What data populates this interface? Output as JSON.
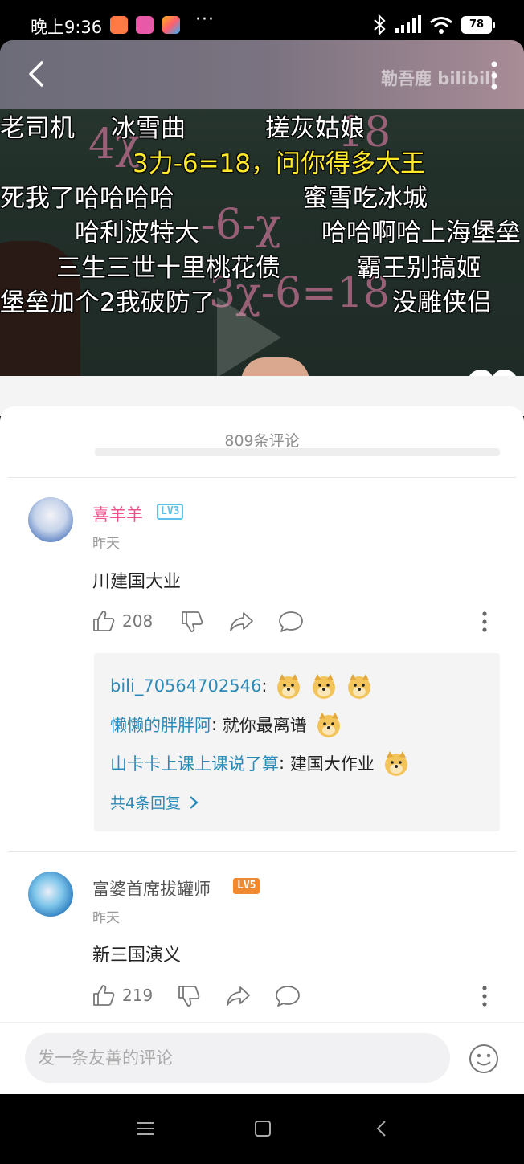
{
  "status_bar": {
    "time": "晚上9:36",
    "dots": "···",
    "battery": "78",
    "app_icon_colors": [
      "#ff7a45",
      "#e85aa8",
      "#ffb21a"
    ]
  },
  "video": {
    "watermark": "勒吾鹿 bilibili",
    "icons": {
      "back": "chevron-left-icon",
      "menu": "more-vertical-icon",
      "heart": "heart-icon"
    },
    "danmaku": [
      {
        "text": "老司机",
        "color": "white"
      },
      {
        "text": "冰雪曲",
        "color": "white"
      },
      {
        "text": "搓灰姑娘",
        "color": "white"
      },
      {
        "text": "3力-6=18，问你得多大王",
        "color": "yellow"
      },
      {
        "text": "死我了哈哈哈哈",
        "color": "white"
      },
      {
        "text": "蜜雪吃冰城",
        "color": "white"
      },
      {
        "text": "哈利波特大",
        "color": "white"
      },
      {
        "text": "哈哈啊哈上海堡垒",
        "color": "white"
      },
      {
        "text": "三生三世十里桃花债",
        "color": "white"
      },
      {
        "text": "霸王别搞姬",
        "color": "white"
      },
      {
        "text": "堡垒加个2我破防了",
        "color": "white"
      },
      {
        "text": "没雕侠侣",
        "color": "white"
      }
    ]
  },
  "comments_header": {
    "count_label": "809条评论"
  },
  "comments": [
    {
      "user": "喜羊羊",
      "level": "LV3",
      "level_color": "#5cc2e6",
      "name_color": "#f0508c",
      "time": "昨天",
      "text": "川建国大业",
      "likes": "208",
      "replies": [
        {
          "name": "bili_70564702546",
          "text": ""
        },
        {
          "name": "懒懒的胖胖阿",
          "text": "就你最离谱"
        },
        {
          "name": "山卡卡上课上课说了算",
          "text": "建国大作业"
        }
      ],
      "replies_total": "共4条回复"
    },
    {
      "user": "富婆首席拔罐师",
      "level": "LV5",
      "level_color": "#f08a30",
      "name_color": "#555555",
      "time": "昨天",
      "text": "新三国演义",
      "likes": "219"
    }
  ],
  "input_bar": {
    "placeholder": "发一条友善的评论",
    "emoji_icon": "emoji-smile-icon"
  },
  "nav_bar": {
    "icons": [
      "menu-icon",
      "home-square-icon",
      "back-icon"
    ]
  }
}
